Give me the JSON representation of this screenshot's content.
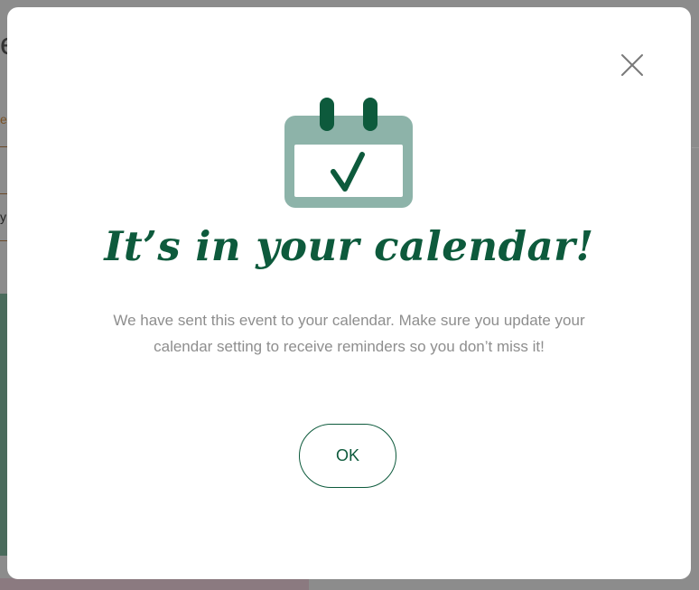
{
  "background_page": {
    "glyph": "e",
    "fragment_a": "e",
    "fragment_b": "y"
  },
  "modal": {
    "close_icon": "close-icon",
    "calendar_icon": "calendar-check-icon",
    "headline": "It’s in your calendar!",
    "message": "We have sent this event to your calendar. Make sure you update your calendar setting to receive reminders so you don’t miss it!",
    "ok_label": "OK"
  },
  "colors": {
    "brand_green": "#0d5a3c",
    "calendar_frame": "#8db3a9",
    "message_text": "#8e8e8e",
    "overlay": "#8a8a8a"
  }
}
